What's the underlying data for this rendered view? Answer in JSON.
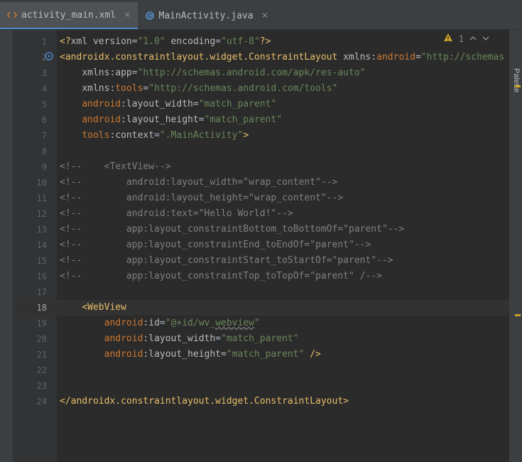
{
  "tabs": [
    {
      "label": "activity_main.xml",
      "icon": "xml",
      "active": true
    },
    {
      "label": "MainActivity.java",
      "icon": "java",
      "active": false
    }
  ],
  "status": {
    "warnings": "1"
  },
  "palette_label": "Palette",
  "current_line": 18,
  "lines": [
    {
      "n": 1,
      "segs": [
        {
          "t": "<?",
          "c": "c-pi"
        },
        {
          "t": "xml version",
          "c": "c-attr"
        },
        {
          "t": "=",
          "c": ""
        },
        {
          "t": "\"1.0\"",
          "c": "c-str"
        },
        {
          "t": " encoding",
          "c": "c-attr"
        },
        {
          "t": "=",
          "c": ""
        },
        {
          "t": "\"utf-8\"",
          "c": "c-str"
        },
        {
          "t": "?>",
          "c": "c-pi"
        }
      ]
    },
    {
      "n": 2,
      "segs": [
        {
          "t": "<androidx.constraintlayout.widget.ConstraintLayout ",
          "c": "c-tag"
        },
        {
          "t": "xmlns:",
          "c": "c-attr"
        },
        {
          "t": "android",
          "c": "c-android"
        },
        {
          "t": "=",
          "c": ""
        },
        {
          "t": "\"http://schemas",
          "c": "c-str"
        }
      ]
    },
    {
      "n": 3,
      "segs": [
        {
          "t": "    ",
          "c": ""
        },
        {
          "t": "xmlns:app",
          "c": "c-attr"
        },
        {
          "t": "=",
          "c": ""
        },
        {
          "t": "\"http://schemas.android.com/apk/res-auto\"",
          "c": "c-str"
        }
      ]
    },
    {
      "n": 4,
      "segs": [
        {
          "t": "    ",
          "c": ""
        },
        {
          "t": "xmlns:",
          "c": "c-attr"
        },
        {
          "t": "tools",
          "c": "c-tools"
        },
        {
          "t": "=",
          "c": ""
        },
        {
          "t": "\"http://schemas.android.com/tools\"",
          "c": "c-str"
        }
      ]
    },
    {
      "n": 5,
      "segs": [
        {
          "t": "    ",
          "c": ""
        },
        {
          "t": "android",
          "c": "c-android"
        },
        {
          "t": ":layout_width",
          "c": "c-attr"
        },
        {
          "t": "=",
          "c": ""
        },
        {
          "t": "\"match_parent\"",
          "c": "c-str"
        }
      ]
    },
    {
      "n": 6,
      "segs": [
        {
          "t": "    ",
          "c": ""
        },
        {
          "t": "android",
          "c": "c-android"
        },
        {
          "t": ":layout_height",
          "c": "c-attr"
        },
        {
          "t": "=",
          "c": ""
        },
        {
          "t": "\"match_parent\"",
          "c": "c-str"
        }
      ]
    },
    {
      "n": 7,
      "segs": [
        {
          "t": "    ",
          "c": ""
        },
        {
          "t": "tools",
          "c": "c-tools"
        },
        {
          "t": ":context",
          "c": "c-attr"
        },
        {
          "t": "=",
          "c": ""
        },
        {
          "t": "\".MainActivity\"",
          "c": "c-str"
        },
        {
          "t": ">",
          "c": "c-tag"
        }
      ]
    },
    {
      "n": 8,
      "segs": [
        {
          "t": "",
          "c": ""
        }
      ]
    },
    {
      "n": 9,
      "segs": [
        {
          "t": "<!--    <TextView-->",
          "c": "c-comment"
        }
      ]
    },
    {
      "n": 10,
      "segs": [
        {
          "t": "<!--        android:layout_width=\"wrap_content\"-->",
          "c": "c-comment"
        }
      ]
    },
    {
      "n": 11,
      "segs": [
        {
          "t": "<!--        android:layout_height=\"wrap_content\"-->",
          "c": "c-comment"
        }
      ]
    },
    {
      "n": 12,
      "segs": [
        {
          "t": "<!--        android:text=\"Hello World!\"-->",
          "c": "c-comment"
        }
      ]
    },
    {
      "n": 13,
      "segs": [
        {
          "t": "<!--        app:layout_constraintBottom_toBottomOf=\"parent\"-->",
          "c": "c-comment"
        }
      ]
    },
    {
      "n": 14,
      "segs": [
        {
          "t": "<!--        app:layout_constraintEnd_toEndOf=\"parent\"-->",
          "c": "c-comment"
        }
      ]
    },
    {
      "n": 15,
      "segs": [
        {
          "t": "<!--        app:layout_constraintStart_toStartOf=\"parent\"-->",
          "c": "c-comment"
        }
      ]
    },
    {
      "n": 16,
      "segs": [
        {
          "t": "<!--        app:layout_constraintTop_toTopOf=\"parent\" /-->",
          "c": "c-comment"
        }
      ]
    },
    {
      "n": 17,
      "segs": [
        {
          "t": "",
          "c": ""
        }
      ]
    },
    {
      "n": 18,
      "segs": [
        {
          "t": "    ",
          "c": ""
        },
        {
          "t": "<WebView",
          "c": "c-tag"
        }
      ]
    },
    {
      "n": 19,
      "segs": [
        {
          "t": "        ",
          "c": ""
        },
        {
          "t": "android",
          "c": "c-android"
        },
        {
          "t": ":id",
          "c": "c-attr"
        },
        {
          "t": "=",
          "c": ""
        },
        {
          "t": "\"@+id/wv_",
          "c": "c-str"
        },
        {
          "t": "webview",
          "c": "c-str warn-wavy"
        },
        {
          "t": "\"",
          "c": "c-str"
        }
      ]
    },
    {
      "n": 20,
      "segs": [
        {
          "t": "        ",
          "c": ""
        },
        {
          "t": "android",
          "c": "c-android"
        },
        {
          "t": ":layout_width",
          "c": "c-attr"
        },
        {
          "t": "=",
          "c": ""
        },
        {
          "t": "\"match_parent\"",
          "c": "c-str"
        }
      ]
    },
    {
      "n": 21,
      "segs": [
        {
          "t": "        ",
          "c": ""
        },
        {
          "t": "android",
          "c": "c-android"
        },
        {
          "t": ":layout_height",
          "c": "c-attr"
        },
        {
          "t": "=",
          "c": ""
        },
        {
          "t": "\"match_parent\"",
          "c": "c-str"
        },
        {
          "t": " />",
          "c": "c-tag"
        }
      ]
    },
    {
      "n": 22,
      "segs": [
        {
          "t": "",
          "c": ""
        }
      ]
    },
    {
      "n": 23,
      "segs": [
        {
          "t": "",
          "c": ""
        }
      ]
    },
    {
      "n": 24,
      "segs": [
        {
          "t": "</androidx.constraintlayout.widget.ConstraintLayout>",
          "c": "c-tag"
        }
      ]
    }
  ]
}
